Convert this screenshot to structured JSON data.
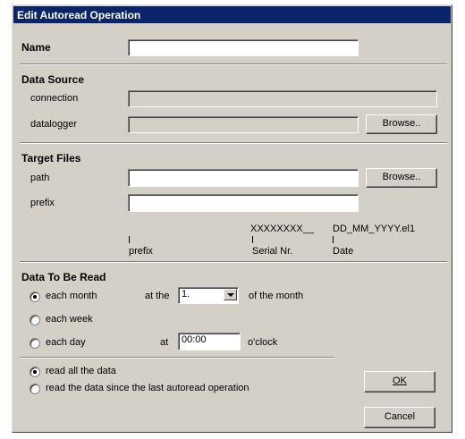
{
  "window": {
    "title": "Edit Autoread Operation"
  },
  "name_section": {
    "label": "Name",
    "value": ""
  },
  "data_source": {
    "heading": "Data Source",
    "connection_label": "connection",
    "connection_value": "",
    "datalogger_label": "datalogger",
    "datalogger_value": "",
    "browse_label": "Browse.."
  },
  "target_files": {
    "heading": "Target Files",
    "path_label": "path",
    "path_value": "",
    "browse_label": "Browse..",
    "prefix_label": "prefix",
    "prefix_value": "",
    "pattern_serial": "XXXXXXXX__",
    "pattern_date": "DD_MM_YYYY.el1",
    "legend_prefix": "prefix",
    "legend_serial": "Serial Nr.",
    "legend_date": "Date"
  },
  "data_to_be_read": {
    "heading": "Data To Be Read",
    "each_month_label": "each month",
    "at_the_label": "at the",
    "day_select_value": "1.",
    "of_the_month_label": "of the month",
    "each_week_label": "each week",
    "each_day_label": "each day",
    "at_label": "at",
    "time_value": "00:00",
    "oclock_label": "o'clock",
    "selected_frequency": "each month"
  },
  "read_mode": {
    "all_data_label": "read all the data",
    "since_last_label": "read the data since the last autoread operation",
    "selected": "read all the data"
  },
  "buttons": {
    "ok_label": "OK",
    "cancel_label": "Cancel"
  }
}
